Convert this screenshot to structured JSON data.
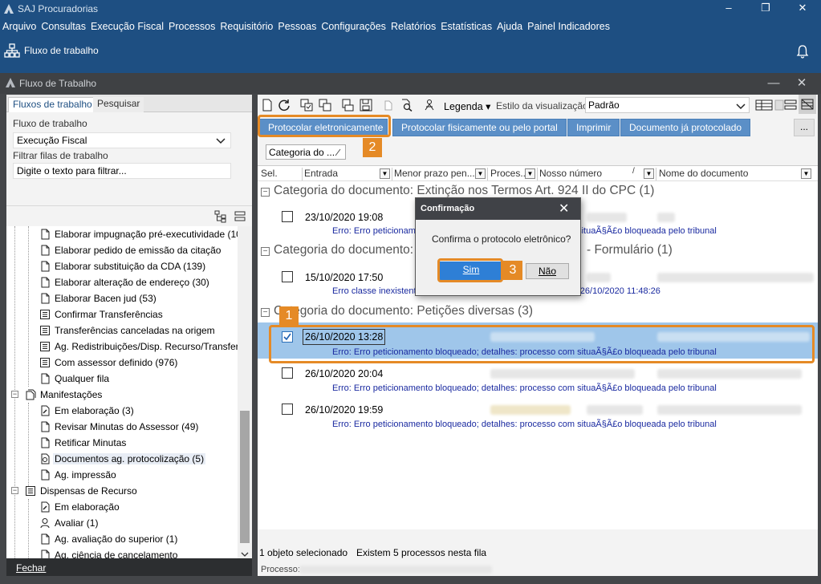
{
  "app": {
    "title": "SAJ Procuradorias",
    "window_controls": [
      "–",
      "❐",
      "✕"
    ]
  },
  "menu": [
    "Arquivo",
    "Consultas",
    "Execução Fiscal",
    "Processos",
    "Requisitório",
    "Pessoas",
    "Configurações",
    "Relatórios",
    "Estatísticas",
    "Ajuda",
    "Painel Indicadores"
  ],
  "tab": {
    "label": "Fluxo de trabalho"
  },
  "inner_window": {
    "title": "Fluxo de Trabalho",
    "controls": [
      "—",
      "✕"
    ]
  },
  "left_panel": {
    "tabs": [
      "Fluxos de trabalho",
      "Pesquisar"
    ],
    "flow_label": "Fluxo de trabalho",
    "flow_value": "Execução Fiscal",
    "filter_label": "Filtrar filas de trabalho",
    "filter_placeholder": "Digite o texto para filtrar...",
    "tree": [
      "Elaborar impugnação pré-executividade (10",
      "Elaborar pedido de emissão da citação",
      "Elaborar substituição da CDA (139)",
      "Elaborar alteração de endereço (30)",
      "Elaborar Bacen jud (53)",
      "Confirmar Transferências",
      "Transferências canceladas na origem",
      "Ag. Redistribuições/Disp. Recurso/Transfer",
      "Com assessor definido (976)",
      "Qualquer fila",
      "Manifestações",
      "Em elaboração (3)",
      "Revisar Minutas do Assessor (49)",
      "Retificar Minutas",
      "Documentos ag. protocolização (5)",
      "Ag. impressão",
      "Dispensas de Recurso",
      "Em elaboração",
      "Avaliar (1)",
      "Ag. avaliação do superior (1)",
      "Ag. ciência de cancelamento"
    ],
    "close_label": "Fechar"
  },
  "toolbar": {
    "legend_label": "Legenda",
    "style_label": "Estilo da visualização",
    "style_value": "Padrão"
  },
  "actions": {
    "protocol_electronic": "Protocolar eletronicamente",
    "protocol_physical": "Protocolar fisicamente ou pelo portal",
    "print": "Imprimir",
    "already_protocoled": "Documento já protocolado",
    "more": "..."
  },
  "group_chip": "Categoria do ...",
  "columns": [
    "Sel.",
    "Entrada",
    "Menor prazo pen...",
    "Proces...",
    "Nosso número",
    "Nome do documento"
  ],
  "groups": [
    {
      "header": "Categoria do documento: Extinção nos Termos Art. 924 II do CPC  (1)",
      "rows": [
        {
          "date": "23/10/2020 19:08",
          "error": "Erro: Erro peticionamento bloqueado; detalhes: processo com situaÃ§Ã£o bloqueada pelo tribunal",
          "checked": false
        }
      ]
    },
    {
      "header": "Categoria do documento:",
      "header_suffix": "- Formulário  (1)",
      "rows": [
        {
          "date": "15/10/2020 17:50",
          "error": "Erro classe inexistente; detalhes: classe não encontrada: 1481 26/10/2020 11:48:26",
          "checked": false
        }
      ]
    },
    {
      "header": "Categoria do documento: Petições diversas  (3)",
      "rows": [
        {
          "date": "26/10/2020 13:28",
          "error": "Erro: Erro peticionamento bloqueado; detalhes: processo com situaÃ§Ã£o bloqueada pelo tribunal",
          "checked": true
        },
        {
          "date": "26/10/2020 20:04",
          "error": "Erro: Erro peticionamento bloqueado; detalhes: processo com situaÃ§Ã£o bloqueada pelo tribunal",
          "checked": false
        },
        {
          "date": "26/10/2020 19:59",
          "error": "Erro: Erro peticionamento bloqueado; detalhes: processo com situaÃ§Ã£o bloqueada pelo tribunal",
          "checked": false
        }
      ]
    }
  ],
  "status": {
    "selected": "1 objeto selecionado",
    "count": "Existem 5 processos nesta fila",
    "processo_label": "Processo:"
  },
  "dialog": {
    "title": "Confirmação",
    "message": "Confirma o protocolo eletrônico?",
    "yes": "Sim",
    "no": "Não"
  },
  "callouts": [
    "1",
    "2",
    "3"
  ],
  "colors": {
    "title_bar": "#1e4f82",
    "action_button": "#5b8fc7",
    "callout": "#e58a26",
    "selected_row": "#9fc6ea",
    "error_text": "#1a2aa0"
  }
}
